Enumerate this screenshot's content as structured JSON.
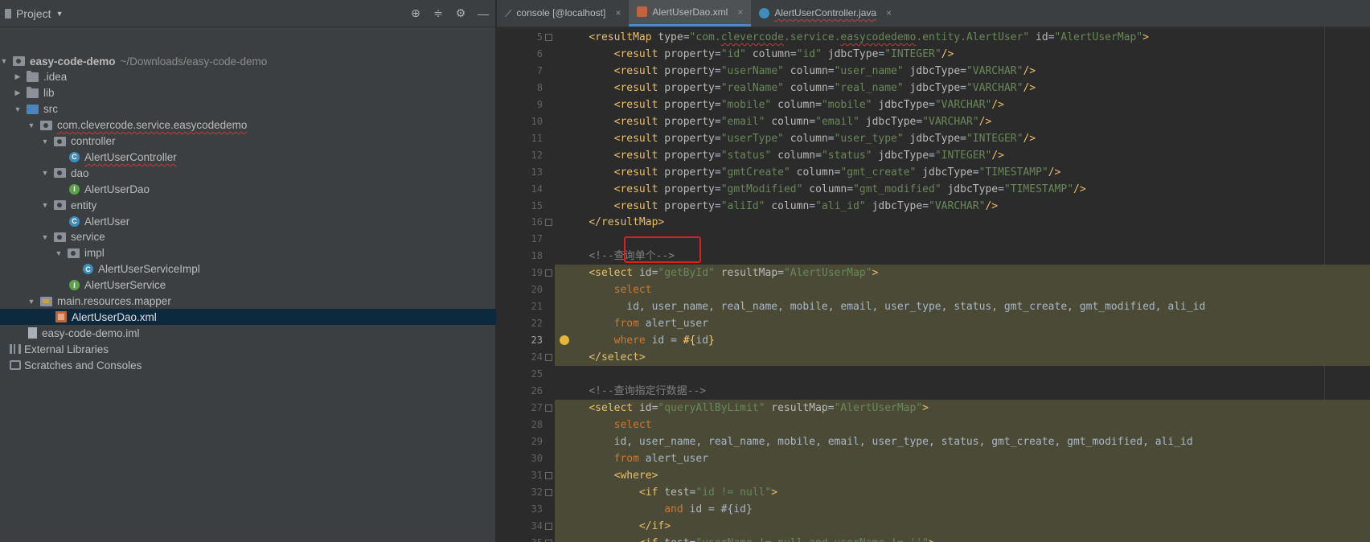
{
  "project_panel": {
    "title": "Project",
    "tree": [
      {
        "indent": 0,
        "arrow": "▼",
        "icon": "pkg",
        "label": "easy-code-demo",
        "sub": "~/Downloads/easy-code-demo",
        "bold": true
      },
      {
        "indent": 1,
        "arrow": "▶",
        "icon": "folder",
        "label": ".idea"
      },
      {
        "indent": 1,
        "arrow": "▶",
        "icon": "folder",
        "label": "lib"
      },
      {
        "indent": 1,
        "arrow": "▼",
        "icon": "src",
        "label": "src"
      },
      {
        "indent": 2,
        "arrow": "▼",
        "icon": "pkg",
        "label": "com.clevercode.service.easycodedemo",
        "squig": true
      },
      {
        "indent": 3,
        "arrow": "▼",
        "icon": "pkg",
        "label": "controller"
      },
      {
        "indent": 4,
        "arrow": "",
        "icon": "cls",
        "label": "AlertUserController",
        "squig": true
      },
      {
        "indent": 3,
        "arrow": "▼",
        "icon": "pkg",
        "label": "dao"
      },
      {
        "indent": 4,
        "arrow": "",
        "icon": "intf",
        "label": "AlertUserDao"
      },
      {
        "indent": 3,
        "arrow": "▼",
        "icon": "pkg",
        "label": "entity"
      },
      {
        "indent": 4,
        "arrow": "",
        "icon": "cls",
        "label": "AlertUser"
      },
      {
        "indent": 3,
        "arrow": "▼",
        "icon": "pkg",
        "label": "service"
      },
      {
        "indent": 4,
        "arrow": "▼",
        "icon": "pkg",
        "label": "impl"
      },
      {
        "indent": 5,
        "arrow": "",
        "icon": "cls",
        "label": "AlertUserServiceImpl"
      },
      {
        "indent": 4,
        "arrow": "",
        "icon": "intf",
        "label": "AlertUserService"
      },
      {
        "indent": 2,
        "arrow": "▼",
        "icon": "res",
        "label": "main.resources.mapper"
      },
      {
        "indent": 3,
        "arrow": "",
        "icon": "xml",
        "label": "AlertUserDao.xml",
        "selected": true
      },
      {
        "indent": 1,
        "arrow": "",
        "icon": "iml",
        "label": "easy-code-demo.iml"
      },
      {
        "indent": 0,
        "arrow": "",
        "icon": "lib",
        "label": "External Libraries"
      },
      {
        "indent": 0,
        "arrow": "",
        "icon": "scratch",
        "label": "Scratches and Consoles"
      }
    ]
  },
  "tabs": [
    {
      "label": "console [@localhost]",
      "icon": "console",
      "active": false
    },
    {
      "label": "AlertUserDao.xml",
      "icon": "xml",
      "active": true
    },
    {
      "label": "AlertUserController.java",
      "icon": "cls",
      "active": false
    }
  ],
  "editor": {
    "current_line": 23,
    "lines": [
      {
        "n": 5,
        "fold": true,
        "hl": false,
        "parts": [
          [
            "    ",
            ""
          ],
          [
            "<resultMap ",
            "t-tag"
          ],
          [
            "type",
            "t-attr"
          ],
          [
            "=",
            "t-id"
          ],
          [
            "\"com.clevercode.service.easycodedemo.entity.AlertUser\"",
            "t-val"
          ],
          [
            " id",
            "t-attr"
          ],
          [
            "=",
            "t-id"
          ],
          [
            "\"AlertUserMap\"",
            "t-val"
          ],
          [
            ">",
            "t-tag"
          ]
        ]
      },
      {
        "n": 6,
        "hl": false,
        "parts": [
          [
            "        ",
            ""
          ],
          [
            "<result ",
            "t-tag"
          ],
          [
            "property",
            "t-attr"
          ],
          [
            "=",
            "t-id"
          ],
          [
            "\"id\"",
            "t-val"
          ],
          [
            " column",
            "t-attr"
          ],
          [
            "=",
            "t-id"
          ],
          [
            "\"id\"",
            "t-val"
          ],
          [
            " jdbcType",
            "t-attr"
          ],
          [
            "=",
            "t-id"
          ],
          [
            "\"INTEGER\"",
            "t-val"
          ],
          [
            "/>",
            "t-tag"
          ]
        ]
      },
      {
        "n": 7,
        "hl": false,
        "parts": [
          [
            "        ",
            ""
          ],
          [
            "<result ",
            "t-tag"
          ],
          [
            "property",
            "t-attr"
          ],
          [
            "=",
            "t-id"
          ],
          [
            "\"userName\"",
            "t-val"
          ],
          [
            " column",
            "t-attr"
          ],
          [
            "=",
            "t-id"
          ],
          [
            "\"user_name\"",
            "t-val"
          ],
          [
            " jdbcType",
            "t-attr"
          ],
          [
            "=",
            "t-id"
          ],
          [
            "\"VARCHAR\"",
            "t-val"
          ],
          [
            "/>",
            "t-tag"
          ]
        ]
      },
      {
        "n": 8,
        "hl": false,
        "parts": [
          [
            "        ",
            ""
          ],
          [
            "<result ",
            "t-tag"
          ],
          [
            "property",
            "t-attr"
          ],
          [
            "=",
            "t-id"
          ],
          [
            "\"realName\"",
            "t-val"
          ],
          [
            " column",
            "t-attr"
          ],
          [
            "=",
            "t-id"
          ],
          [
            "\"real_name\"",
            "t-val"
          ],
          [
            " jdbcType",
            "t-attr"
          ],
          [
            "=",
            "t-id"
          ],
          [
            "\"VARCHAR\"",
            "t-val"
          ],
          [
            "/>",
            "t-tag"
          ]
        ]
      },
      {
        "n": 9,
        "hl": false,
        "parts": [
          [
            "        ",
            ""
          ],
          [
            "<result ",
            "t-tag"
          ],
          [
            "property",
            "t-attr"
          ],
          [
            "=",
            "t-id"
          ],
          [
            "\"mobile\"",
            "t-val"
          ],
          [
            " column",
            "t-attr"
          ],
          [
            "=",
            "t-id"
          ],
          [
            "\"mobile\"",
            "t-val"
          ],
          [
            " jdbcType",
            "t-attr"
          ],
          [
            "=",
            "t-id"
          ],
          [
            "\"VARCHAR\"",
            "t-val"
          ],
          [
            "/>",
            "t-tag"
          ]
        ]
      },
      {
        "n": 10,
        "hl": false,
        "parts": [
          [
            "        ",
            ""
          ],
          [
            "<result ",
            "t-tag"
          ],
          [
            "property",
            "t-attr"
          ],
          [
            "=",
            "t-id"
          ],
          [
            "\"email\"",
            "t-val"
          ],
          [
            " column",
            "t-attr"
          ],
          [
            "=",
            "t-id"
          ],
          [
            "\"email\"",
            "t-val"
          ],
          [
            " jdbcType",
            "t-attr"
          ],
          [
            "=",
            "t-id"
          ],
          [
            "\"VARCHAR\"",
            "t-val"
          ],
          [
            "/>",
            "t-tag"
          ]
        ]
      },
      {
        "n": 11,
        "hl": false,
        "parts": [
          [
            "        ",
            ""
          ],
          [
            "<result ",
            "t-tag"
          ],
          [
            "property",
            "t-attr"
          ],
          [
            "=",
            "t-id"
          ],
          [
            "\"userType\"",
            "t-val"
          ],
          [
            " column",
            "t-attr"
          ],
          [
            "=",
            "t-id"
          ],
          [
            "\"user_type\"",
            "t-val"
          ],
          [
            " jdbcType",
            "t-attr"
          ],
          [
            "=",
            "t-id"
          ],
          [
            "\"INTEGER\"",
            "t-val"
          ],
          [
            "/>",
            "t-tag"
          ]
        ]
      },
      {
        "n": 12,
        "hl": false,
        "parts": [
          [
            "        ",
            ""
          ],
          [
            "<result ",
            "t-tag"
          ],
          [
            "property",
            "t-attr"
          ],
          [
            "=",
            "t-id"
          ],
          [
            "\"status\"",
            "t-val"
          ],
          [
            " column",
            "t-attr"
          ],
          [
            "=",
            "t-id"
          ],
          [
            "\"status\"",
            "t-val"
          ],
          [
            " jdbcType",
            "t-attr"
          ],
          [
            "=",
            "t-id"
          ],
          [
            "\"INTEGER\"",
            "t-val"
          ],
          [
            "/>",
            "t-tag"
          ]
        ]
      },
      {
        "n": 13,
        "hl": false,
        "parts": [
          [
            "        ",
            ""
          ],
          [
            "<result ",
            "t-tag"
          ],
          [
            "property",
            "t-attr"
          ],
          [
            "=",
            "t-id"
          ],
          [
            "\"gmtCreate\"",
            "t-val"
          ],
          [
            " column",
            "t-attr"
          ],
          [
            "=",
            "t-id"
          ],
          [
            "\"gmt_create\"",
            "t-val"
          ],
          [
            " jdbcType",
            "t-attr"
          ],
          [
            "=",
            "t-id"
          ],
          [
            "\"TIMESTAMP\"",
            "t-val"
          ],
          [
            "/>",
            "t-tag"
          ]
        ]
      },
      {
        "n": 14,
        "hl": false,
        "parts": [
          [
            "        ",
            ""
          ],
          [
            "<result ",
            "t-tag"
          ],
          [
            "property",
            "t-attr"
          ],
          [
            "=",
            "t-id"
          ],
          [
            "\"gmtModified\"",
            "t-val"
          ],
          [
            " column",
            "t-attr"
          ],
          [
            "=",
            "t-id"
          ],
          [
            "\"gmt_modified\"",
            "t-val"
          ],
          [
            " jdbcType",
            "t-attr"
          ],
          [
            "=",
            "t-id"
          ],
          [
            "\"TIMESTAMP\"",
            "t-val"
          ],
          [
            "/>",
            "t-tag"
          ]
        ]
      },
      {
        "n": 15,
        "hl": false,
        "parts": [
          [
            "        ",
            ""
          ],
          [
            "<result ",
            "t-tag"
          ],
          [
            "property",
            "t-attr"
          ],
          [
            "=",
            "t-id"
          ],
          [
            "\"aliId\"",
            "t-val"
          ],
          [
            " column",
            "t-attr"
          ],
          [
            "=",
            "t-id"
          ],
          [
            "\"ali_id\"",
            "t-val"
          ],
          [
            " jdbcType",
            "t-attr"
          ],
          [
            "=",
            "t-id"
          ],
          [
            "\"VARCHAR\"",
            "t-val"
          ],
          [
            "/>",
            "t-tag"
          ]
        ]
      },
      {
        "n": 16,
        "fold": true,
        "hl": false,
        "parts": [
          [
            "    ",
            ""
          ],
          [
            "</resultMap>",
            "t-tag"
          ]
        ]
      },
      {
        "n": 17,
        "hl": false,
        "parts": []
      },
      {
        "n": 18,
        "hl": false,
        "parts": [
          [
            "    ",
            ""
          ],
          [
            "<!--查询单个-->",
            "t-cm"
          ]
        ]
      },
      {
        "n": 19,
        "fold": true,
        "hl": true,
        "hl_from": 0,
        "parts": [
          [
            "    ",
            ""
          ],
          [
            "<select ",
            "t-tag"
          ],
          [
            "id",
            "t-attr"
          ],
          [
            "=",
            "t-id"
          ],
          [
            "\"getById\"",
            "t-val"
          ],
          [
            " resultMap",
            "t-attr"
          ],
          [
            "=",
            "t-id"
          ],
          [
            "\"AlertUserMap\"",
            "t-val"
          ],
          [
            ">",
            "t-tag"
          ]
        ]
      },
      {
        "n": 20,
        "hl": true,
        "parts": [
          [
            "        ",
            ""
          ],
          [
            "select",
            "t-kw"
          ]
        ]
      },
      {
        "n": 21,
        "hl": true,
        "parts": [
          [
            "          ",
            ""
          ],
          [
            "id, user_name, real_name, mobile, email, user_type, status, gmt_create, gmt_modified, ali_id",
            "t-id"
          ]
        ]
      },
      {
        "n": 22,
        "hl": true,
        "parts": [
          [
            "        ",
            ""
          ],
          [
            "from ",
            "t-kw"
          ],
          [
            "alert_user",
            "t-id"
          ]
        ]
      },
      {
        "n": 23,
        "hl": true,
        "bulb": true,
        "parts": [
          [
            "        ",
            ""
          ],
          [
            "where ",
            "t-kw"
          ],
          [
            "id = ",
            "t-id"
          ],
          [
            "#{",
            "t-ph"
          ],
          [
            "id",
            "t-id"
          ],
          [
            "}",
            "t-ph"
          ]
        ]
      },
      {
        "n": 24,
        "fold": true,
        "hl": true,
        "parts": [
          [
            "    ",
            ""
          ],
          [
            "</select>",
            "t-tag"
          ]
        ]
      },
      {
        "n": 25,
        "hl": false,
        "parts": []
      },
      {
        "n": 26,
        "hl": false,
        "parts": [
          [
            "    ",
            ""
          ],
          [
            "<!--查询指定行数据-->",
            "t-cm"
          ]
        ]
      },
      {
        "n": 27,
        "fold": true,
        "hl": true,
        "parts": [
          [
            "    ",
            ""
          ],
          [
            "<select ",
            "t-tag"
          ],
          [
            "id",
            "t-attr"
          ],
          [
            "=",
            "t-id"
          ],
          [
            "\"queryAllByLimit\"",
            "t-val"
          ],
          [
            " resultMap",
            "t-attr"
          ],
          [
            "=",
            "t-id"
          ],
          [
            "\"AlertUserMap\"",
            "t-val"
          ],
          [
            ">",
            "t-tag"
          ]
        ]
      },
      {
        "n": 28,
        "hl": true,
        "parts": [
          [
            "        ",
            ""
          ],
          [
            "select",
            "t-kw"
          ]
        ]
      },
      {
        "n": 29,
        "hl": true,
        "parts": [
          [
            "        ",
            ""
          ],
          [
            "id, user_name, real_name, mobile, email, user_type, status, gmt_create, gmt_modified, ali_id",
            "t-id"
          ]
        ]
      },
      {
        "n": 30,
        "hl": true,
        "parts": [
          [
            "        ",
            ""
          ],
          [
            "from ",
            "t-kw"
          ],
          [
            "alert_user",
            "t-id"
          ]
        ]
      },
      {
        "n": 31,
        "fold": true,
        "hl": true,
        "parts": [
          [
            "        ",
            ""
          ],
          [
            "<where>",
            "t-tag"
          ]
        ]
      },
      {
        "n": 32,
        "fold": true,
        "hl": true,
        "parts": [
          [
            "            ",
            ""
          ],
          [
            "<if ",
            "t-tag"
          ],
          [
            "test",
            "t-attr"
          ],
          [
            "=",
            "t-id"
          ],
          [
            "\"id != null\"",
            "t-val"
          ],
          [
            ">",
            "t-tag"
          ]
        ]
      },
      {
        "n": 33,
        "hl": true,
        "parts": [
          [
            "                ",
            ""
          ],
          [
            "and ",
            "t-kw"
          ],
          [
            "id = #{id}",
            "t-id"
          ]
        ]
      },
      {
        "n": 34,
        "fold": true,
        "hl": true,
        "parts": [
          [
            "            ",
            ""
          ],
          [
            "</if>",
            "t-tag"
          ]
        ]
      },
      {
        "n": 35,
        "fold": true,
        "hl": true,
        "parts": [
          [
            "            ",
            ""
          ],
          [
            "<if ",
            "t-tag"
          ],
          [
            "test",
            "t-attr"
          ],
          [
            "=",
            "t-id"
          ],
          [
            "\"userName != null and userName != ''\"",
            "t-val"
          ],
          [
            ">",
            "t-tag"
          ]
        ]
      }
    ]
  }
}
